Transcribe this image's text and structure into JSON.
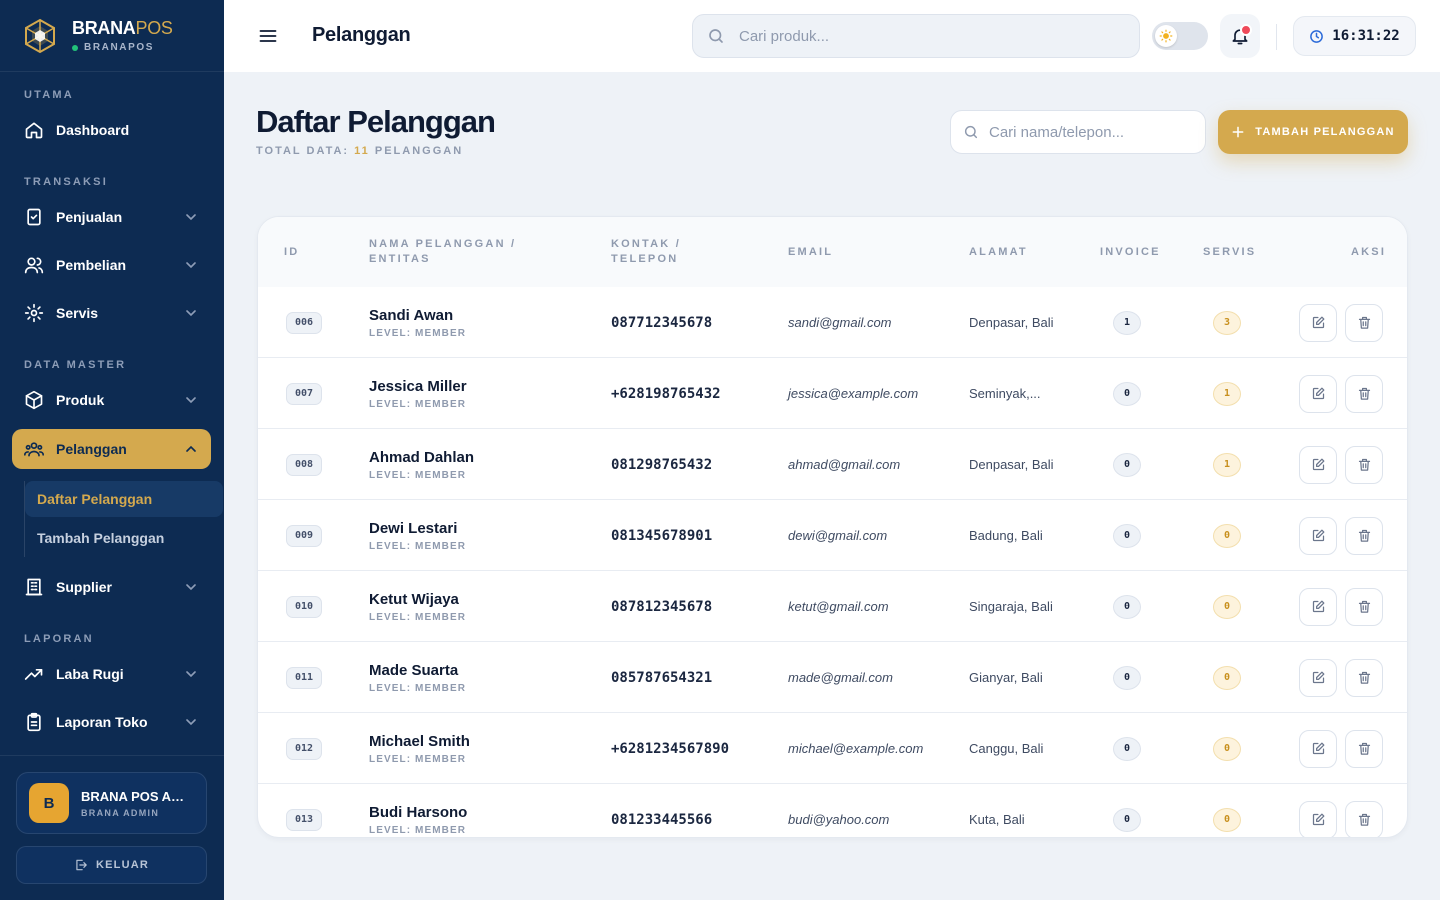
{
  "brand": {
    "name_part1": "BRANA",
    "name_part2": "POS",
    "subtitle": "BRANAPOS"
  },
  "sidebar": {
    "sections": {
      "utama": "UTAMA",
      "transaksi": "TRANSAKSI",
      "data_master": "DATA MASTER",
      "laporan": "LAPORAN"
    },
    "items": {
      "dashboard": "Dashboard",
      "penjualan": "Penjualan",
      "pembelian": "Pembelian",
      "servis": "Servis",
      "produk": "Produk",
      "pelanggan": "Pelanggan",
      "supplier": "Supplier",
      "laba_rugi": "Laba Rugi",
      "laporan_toko": "Laporan Toko"
    },
    "subitems": {
      "daftar": "Daftar Pelanggan",
      "tambah": "Tambah Pelanggan"
    },
    "user": {
      "initial": "B",
      "name": "BRANA POS ADMIN",
      "role": "BRANA ADMIN"
    },
    "logout": "KELUAR"
  },
  "topbar": {
    "title": "Pelanggan",
    "search_placeholder": "Cari produk...",
    "time": "16:31:22"
  },
  "colors": {
    "sidebar_bg": "#0d2b52",
    "accent": "#d4a94e",
    "background": "#eef2f7"
  },
  "content": {
    "heading": "Daftar Pelanggan",
    "total_prefix": "TOTAL DATA:",
    "total_count": "11",
    "total_suffix": "PELANGGAN",
    "search_placeholder": "Cari nama/telepon...",
    "add_button": "TAMBAH PELANGGAN"
  },
  "table": {
    "headers": {
      "id": "ID",
      "name": "NAMA PELANGGAN / ENTITAS",
      "contact": "KONTAK / TELEPON",
      "email": "EMAIL",
      "address": "ALAMAT",
      "invoice": "INVOICE",
      "servis": "SERVIS",
      "action": "AKSI"
    },
    "rows": [
      {
        "id": "006",
        "name": "Sandi Awan",
        "level": "LEVEL: MEMBER",
        "phone": "087712345678",
        "email": "sandi@gmail.com",
        "address": "Denpasar, Bali",
        "invoice": "1",
        "servis": "3"
      },
      {
        "id": "007",
        "name": "Jessica Miller",
        "level": "LEVEL: MEMBER",
        "phone": "+628198765432",
        "email": "jessica@example.com",
        "address": "Seminyak,...",
        "invoice": "0",
        "servis": "1"
      },
      {
        "id": "008",
        "name": "Ahmad Dahlan",
        "level": "LEVEL: MEMBER",
        "phone": "081298765432",
        "email": "ahmad@gmail.com",
        "address": "Denpasar, Bali",
        "invoice": "0",
        "servis": "1"
      },
      {
        "id": "009",
        "name": "Dewi Lestari",
        "level": "LEVEL: MEMBER",
        "phone": "081345678901",
        "email": "dewi@gmail.com",
        "address": "Badung, Bali",
        "invoice": "0",
        "servis": "0"
      },
      {
        "id": "010",
        "name": "Ketut Wijaya",
        "level": "LEVEL: MEMBER",
        "phone": "087812345678",
        "email": "ketut@gmail.com",
        "address": "Singaraja, Bali",
        "invoice": "0",
        "servis": "0"
      },
      {
        "id": "011",
        "name": "Made Suarta",
        "level": "LEVEL: MEMBER",
        "phone": "085787654321",
        "email": "made@gmail.com",
        "address": "Gianyar, Bali",
        "invoice": "0",
        "servis": "0"
      },
      {
        "id": "012",
        "name": "Michael Smith",
        "level": "LEVEL: MEMBER",
        "phone": "+6281234567890",
        "email": "michael@example.com",
        "address": "Canggu, Bali",
        "invoice": "0",
        "servis": "0"
      },
      {
        "id": "013",
        "name": "Budi Harsono",
        "level": "LEVEL: MEMBER",
        "phone": "081233445566",
        "email": "budi@yahoo.com",
        "address": "Kuta, Bali",
        "invoice": "0",
        "servis": "0"
      }
    ]
  }
}
